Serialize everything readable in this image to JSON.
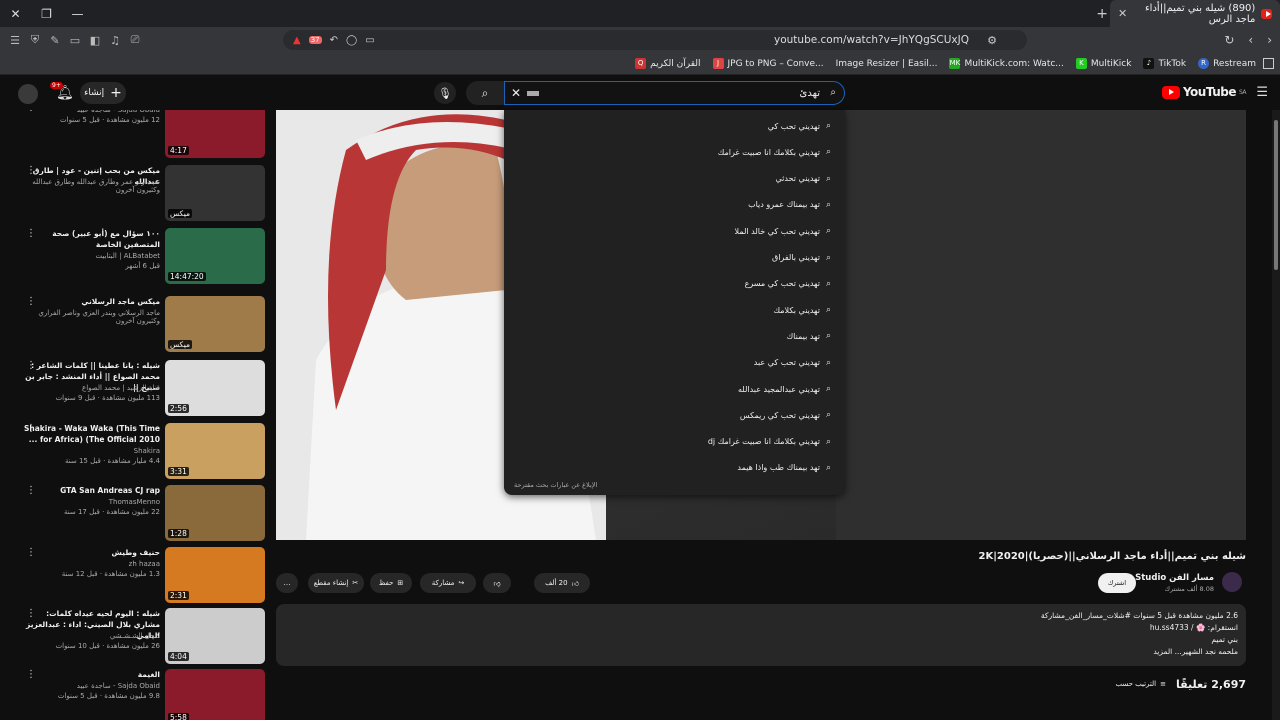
{
  "browser": {
    "tab_title": "(890) شيله بني تميم||أداء ماجد الرس",
    "url": "youtube.com/watch?v=JhYQgSCUxJQ",
    "ext_badge": "37",
    "bookmarks": [
      "القرآن الكريم",
      "JPG to PNG – Conve...",
      "Image Resizer | Easil...",
      "MultiKick.com: Watc...",
      "MultiKick",
      "TikTok",
      "Restream"
    ]
  },
  "youtube": {
    "create_label": "إنشاء",
    "notif_badge": "9+",
    "search_value": "تهدئ",
    "logo_text": "YouTube",
    "logo_region": "SA",
    "suggestions": [
      "تهديني تحب كي",
      "تهديني بكلامك انا صبيت غرامك",
      "تهديني تحدثي",
      "تهد بيمناك عمرو دياب",
      "تهديني تحب كي خالد الملا",
      "تهديني بالفراق",
      "تهديني تحب كي مسرع",
      "تهديني بكلامك",
      "تهد بيمناك",
      "تهديني تحب كي عبد",
      "تهديني عبدالمجيد عبدالله",
      "تهديني تحب كي ريمكس",
      "تهديني بكلامك انا صبيت غرامك dj",
      "تهد بيمناك طب واذا هيمد"
    ],
    "report_text": "الإبلاغ عن عبارات بحث مقترحة"
  },
  "video": {
    "title": "شيله بني تميم||أداء ماجد الرسلاني||(حصريا)|2020|2K",
    "channel": "مسار الفن Studio",
    "subs": "8.08 ألف مشترك",
    "subscribe": "اشترك",
    "likes": "20 ألف",
    "share": "مشاركة",
    "save": "حفظ",
    "clip": "إنشاء مقطع",
    "desc_line1": "2.6 مليون مشاهدة  قبل 5 سنوات  #شلات_مسار_الفن_مشاركة",
    "desc_line2": "انستقرام: 🌸 / hu.ss4733",
    "desc_line3": "بني تميم",
    "desc_line4": "ملحمه نجد الشهير... المزيد",
    "comments_count": "2,697 تعليقًا",
    "sort_label": "الترتيب حسب"
  },
  "recommendations": [
    {
      "title": "",
      "channel": "Sajda Obaid - ساجدة عبيد",
      "meta": "12 مليون مشاهدة · قبل 5 سنوات",
      "duration": "4:17"
    },
    {
      "title": "ميكس من بحب إتنين - عود | طارق عبدالله",
      "channel": "",
      "meta": "نعمة وتر عمر وطارق عبدالله وطارق عبدالله وكثيرون آخرون",
      "duration": "ميكس"
    },
    {
      "title": "١٠٠ سؤال مع (أبو عبير) صحة المتصفين الخاصة",
      "channel": "ALBatabet | البتابيت",
      "meta": "قبل 6 أشهر",
      "duration": "14:47:20"
    },
    {
      "title": "ميكس ماجد الرسلاني",
      "channel": "",
      "meta": "ماجد الرسلاني وبندر العزي وناصر الفراري وكثيرون آخرون",
      "duration": "ميكس"
    },
    {
      "title": "شيله : يانا عطينا || كلمات الشاعر : محمد الصواع || أداء المنشد : جابر بن صبيح ||",
      "channel": "قناة الرشيد | محمد الصواع",
      "meta": "113 مليون مشاهدة · قبل 9 سنوات",
      "duration": "2:56"
    },
    {
      "title": "Shakira - Waka Waka (This Time for Africa) (The Official 2010 ...",
      "channel": "Shakira",
      "meta": "4.4 مليار مشاهدة · قبل 15 سنة",
      "duration": "3:31"
    },
    {
      "title": "GTA San Andreas CJ rap",
      "channel": "ThomasMenno",
      "meta": "22 مليون مشاهدة · قبل 17 سنة",
      "duration": "1:28"
    },
    {
      "title": "حنيف وطيش",
      "channel": "zh hazaa",
      "meta": "1.3 مليون مشاهدة · قبل 12 سنة",
      "duration": "2:31"
    },
    {
      "title": "شيله : اليوم لحيه عيداه كلمات: مشاري بلال الصيني: اداء : عبدالعزيز اليامي",
      "channel": "كـحل الشـشـشي",
      "meta": "26 مليون مشاهدة · قبل 10 سنوات",
      "duration": "4:04"
    },
    {
      "title": "الغيمة",
      "channel": "Sajda Obaid - ساجدة عبيد",
      "meta": "9.8 مليون مشاهدة · قبل 5 سنوات",
      "duration": "5:58"
    }
  ],
  "colors": {
    "bg": "#0f0f0f",
    "accent": "#ff0000",
    "search_border": "#1c62b9"
  }
}
